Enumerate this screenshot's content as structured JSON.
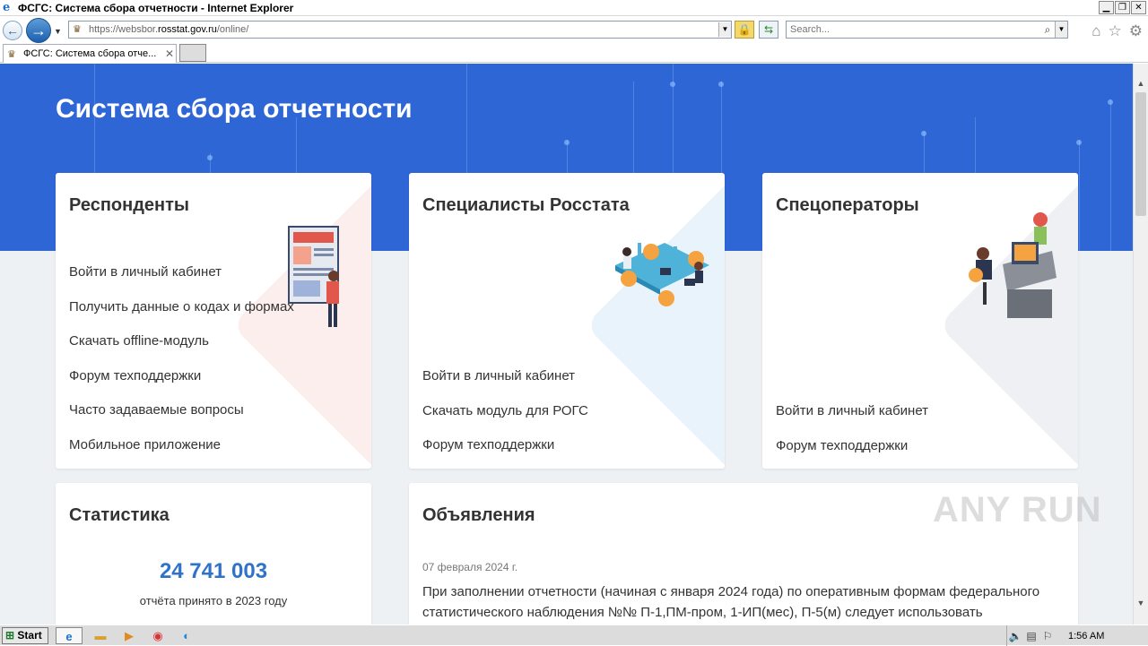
{
  "browser": {
    "window_title": "ФСГС: Система сбора отчетности - Internet Explorer",
    "url_prefix": "https://websbor.",
    "url_domain": "rosstat.gov.ru",
    "url_path": "/online/",
    "search_placeholder": "Search...",
    "tab_title": "ФСГС: Система сбора отче...",
    "icons": [
      "ie-logo-icon",
      "back-arrow-icon",
      "forward-arrow-icon",
      "lock-icon",
      "refresh-icon",
      "search-icon",
      "home-icon",
      "favorites-star-icon",
      "gear-icon"
    ]
  },
  "page": {
    "hero_title": "Система сбора отчетности",
    "cards": {
      "respondents": {
        "title": "Респонденты",
        "links": [
          "Войти в личный кабинет",
          "Получить данные о кодах и формах",
          "Скачать offline-модуль",
          "Форум техподдержки",
          "Часто задаваемые вопросы",
          "Мобильное приложение"
        ]
      },
      "specialists": {
        "title": "Специалисты Росстата",
        "links": [
          "Войти в личный кабинет",
          "Скачать модуль для РОГС",
          "Форум техподдержки"
        ]
      },
      "operators": {
        "title": "Спецоператоры",
        "links": [
          "Войти в личный кабинет",
          "Форум техподдержки"
        ]
      }
    },
    "stats": {
      "title": "Статистика",
      "number": "24 741 003",
      "caption": "отчёта принято в 2023 году"
    },
    "news": {
      "title": "Объявления",
      "date": "07 февраля 2024 г.",
      "text": "При заполнении отчетности (начиная с января 2024 года) по оперативным формам федерального статистического наблюдения №№ П-1,ПМ-пром, 1-ИП(мес), П-5(м) следует использовать"
    },
    "watermark": "ANY RUN"
  },
  "taskbar": {
    "start_label": "Start",
    "time": "1:56 AM"
  },
  "colors": {
    "hero_blue": "#2f66d6",
    "stat_blue": "#2f73c9"
  }
}
